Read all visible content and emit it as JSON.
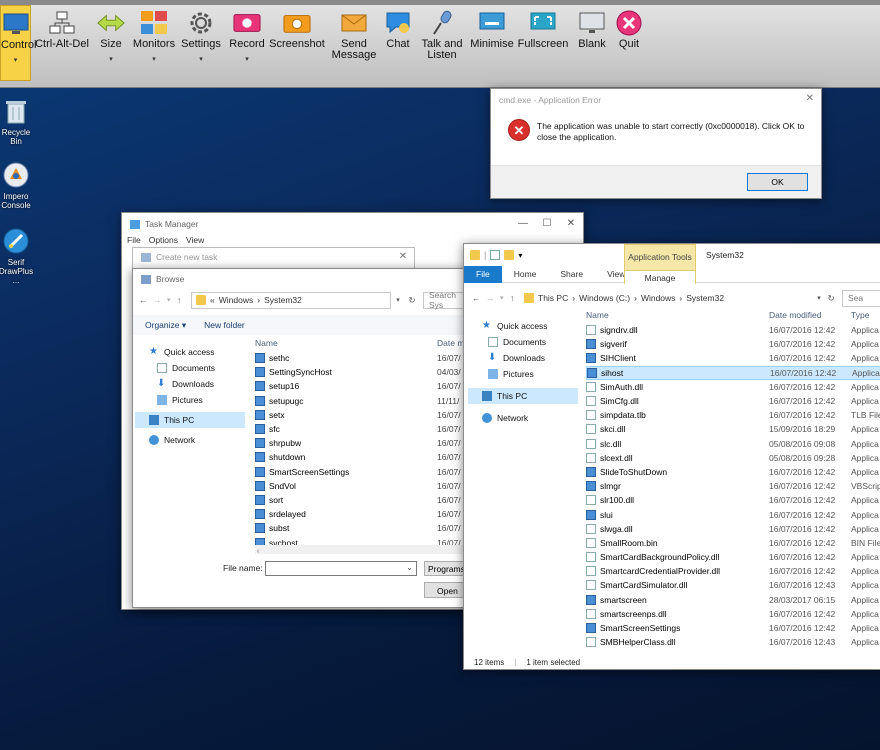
{
  "toolbar": {
    "buttons": [
      {
        "label": "Control",
        "label2": "",
        "icon": "monitor-icon",
        "caret": true
      },
      {
        "label": "Ctrl-Alt-Del",
        "label2": "",
        "icon": "network-icon",
        "caret": false
      },
      {
        "label": "Size",
        "label2": "",
        "icon": "resize-arrows-icon",
        "caret": true
      },
      {
        "label": "Monitors",
        "label2": "",
        "icon": "monitors-icon",
        "caret": true
      },
      {
        "label": "Settings",
        "label2": "",
        "icon": "gear-icon",
        "caret": true
      },
      {
        "label": "Record",
        "label2": "",
        "icon": "record-icon",
        "caret": true
      },
      {
        "label": "Screenshot",
        "label2": "",
        "icon": "camera-icon",
        "caret": false
      },
      {
        "label": "Send",
        "label2": "Message",
        "icon": "envelope-icon",
        "caret": false
      },
      {
        "label": "Chat",
        "label2": "",
        "icon": "chat-icon",
        "caret": false
      },
      {
        "label": "Talk and",
        "label2": "Listen",
        "icon": "microphone-icon",
        "caret": false
      },
      {
        "label": "Minimise",
        "label2": "",
        "icon": "minimise-icon",
        "caret": false
      },
      {
        "label": "Fullscreen",
        "label2": "",
        "icon": "fullscreen-icon",
        "caret": false
      },
      {
        "label": "Blank",
        "label2": "",
        "icon": "blank-screen-icon",
        "caret": false
      },
      {
        "label": "Quit",
        "label2": "",
        "icon": "quit-icon",
        "caret": false
      }
    ]
  },
  "desktop": {
    "icons": [
      {
        "label1": "Recycle Bin",
        "label2": ""
      },
      {
        "label1": "Impero",
        "label2": "Console"
      },
      {
        "label1": "Serif",
        "label2": "DrawPlus ..."
      }
    ]
  },
  "error_dialog": {
    "title": "cmd.exe - Application Error",
    "message": "The application was unable to start correctly (0xc0000018). Click OK to close the application.",
    "ok": "OK",
    "close": "✕"
  },
  "task_manager": {
    "title": "Task Manager",
    "menu": [
      "File",
      "Options",
      "View"
    ]
  },
  "create_task": {
    "title": "Create new task",
    "close": "✕"
  },
  "browse": {
    "title": "Browse",
    "path": [
      "«",
      "Windows",
      "›",
      "System32"
    ],
    "search": "Search Sys",
    "organize": "Organize ▾",
    "new_folder": "New folder",
    "nav": [
      "Quick access",
      "Documents",
      "Downloads",
      "Pictures",
      "This PC",
      "Network"
    ],
    "col_name": "Name",
    "col_date": "Date m",
    "files": [
      {
        "name": "sethc",
        "date": "16/07/"
      },
      {
        "name": "SettingSyncHost",
        "date": "04/03/"
      },
      {
        "name": "setup16",
        "date": "16/07/"
      },
      {
        "name": "setupugc",
        "date": "11/11/"
      },
      {
        "name": "setx",
        "date": "16/07/"
      },
      {
        "name": "sfc",
        "date": "16/07/"
      },
      {
        "name": "shrpubw",
        "date": "16/07/"
      },
      {
        "name": "shutdown",
        "date": "16/07/"
      },
      {
        "name": "SmartScreenSettings",
        "date": "16/07/"
      },
      {
        "name": "SndVol",
        "date": "16/07/"
      },
      {
        "name": "sort",
        "date": "16/07/"
      },
      {
        "name": "srdelayed",
        "date": "16/07/"
      },
      {
        "name": "subst",
        "date": "16/07/"
      },
      {
        "name": "svchost",
        "date": "16/07/"
      }
    ],
    "file_name_label": "File name:",
    "filter": "Programs",
    "open": "Open"
  },
  "explorer": {
    "title": "System32",
    "app_tools": "Application Tools",
    "manage": "Manage",
    "tabs": [
      "File",
      "Home",
      "Share",
      "View"
    ],
    "path": [
      "This PC",
      "›",
      "Windows (C:)",
      "›",
      "Windows",
      "›",
      "System32"
    ],
    "search": "Sea",
    "nav": [
      "Quick access",
      "Documents",
      "Downloads",
      "Pictures",
      "This PC",
      "Network"
    ],
    "cols": {
      "name": "Name",
      "date": "Date modified",
      "type": "Type"
    },
    "files": [
      {
        "name": "signdrv.dll",
        "date": "16/07/2016 12:42",
        "type": "Applica"
      },
      {
        "name": "sigverif",
        "date": "16/07/2016 12:42",
        "type": "Applica"
      },
      {
        "name": "SIHClient",
        "date": "16/07/2016 12:42",
        "type": "Applica"
      },
      {
        "name": "sihost",
        "date": "16/07/2016 12:42",
        "type": "Applica"
      },
      {
        "name": "SimAuth.dll",
        "date": "16/07/2016 12:42",
        "type": "Applica"
      },
      {
        "name": "SimCfg.dll",
        "date": "16/07/2016 12:42",
        "type": "Applica"
      },
      {
        "name": "simpdata.tlb",
        "date": "16/07/2016 12:42",
        "type": "TLB File"
      },
      {
        "name": "skci.dll",
        "date": "15/09/2016 18:29",
        "type": "Applica"
      },
      {
        "name": "slc.dll",
        "date": "05/08/2016 09:08",
        "type": "Applica"
      },
      {
        "name": "slcext.dll",
        "date": "05/08/2016 09:28",
        "type": "Applica"
      },
      {
        "name": "SlideToShutDown",
        "date": "16/07/2016 12:42",
        "type": "Applica"
      },
      {
        "name": "slmgr",
        "date": "16/07/2016 12:42",
        "type": "VBScrip"
      },
      {
        "name": "slr100.dll",
        "date": "16/07/2016 12:42",
        "type": "Applica"
      },
      {
        "name": "slui",
        "date": "16/07/2016 12:42",
        "type": "Applica"
      },
      {
        "name": "slwga.dll",
        "date": "16/07/2016 12:42",
        "type": "Applica"
      },
      {
        "name": "SmallRoom.bin",
        "date": "16/07/2016 12:42",
        "type": "BIN File"
      },
      {
        "name": "SmartCardBackgroundPolicy.dll",
        "date": "16/07/2016 12:42",
        "type": "Applica"
      },
      {
        "name": "SmartcardCredentialProvider.dll",
        "date": "16/07/2016 12:42",
        "type": "Applica"
      },
      {
        "name": "SmartCardSimulator.dll",
        "date": "16/07/2016 12:43",
        "type": "Applica"
      },
      {
        "name": "smartscreen",
        "date": "28/03/2017 06:15",
        "type": "Applica"
      },
      {
        "name": "smartscreenps.dll",
        "date": "16/07/2016 12:42",
        "type": "Applica"
      },
      {
        "name": "SmartScreenSettings",
        "date": "16/07/2016 12:42",
        "type": "Applica"
      },
      {
        "name": "SMBHelperClass.dll",
        "date": "16/07/2016 12:43",
        "type": "Applica"
      }
    ],
    "status_count": "12 items",
    "status_selected": "1 item selected"
  }
}
